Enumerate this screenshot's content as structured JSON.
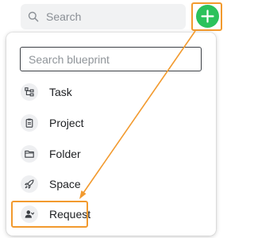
{
  "header": {
    "search_label": "Search",
    "search_icon": "search-icon",
    "add_icon": "plus-icon"
  },
  "menu": {
    "search_placeholder": "Search blueprint",
    "items": [
      {
        "label": "Task",
        "icon": "task-tree-icon"
      },
      {
        "label": "Project",
        "icon": "clipboard-icon"
      },
      {
        "label": "Folder",
        "icon": "folder-icon"
      },
      {
        "label": "Space",
        "icon": "rocket-icon"
      },
      {
        "label": "Request",
        "icon": "user-request-icon"
      }
    ]
  },
  "colors": {
    "accent_green": "#2bc25b",
    "annotation_orange": "#f29a2e"
  }
}
